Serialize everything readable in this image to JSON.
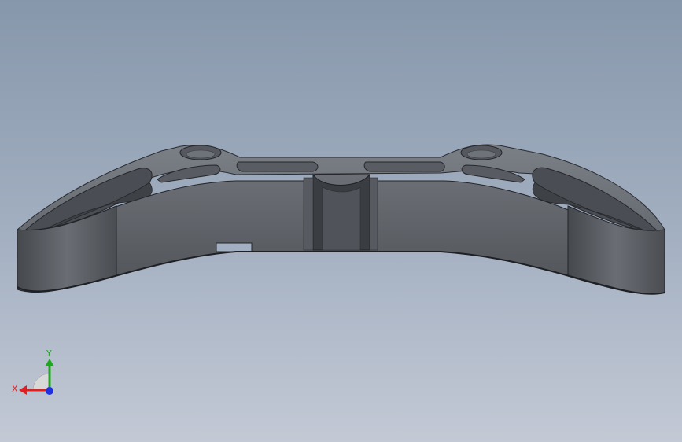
{
  "viewport": {
    "background_top": "#8797ab",
    "background_bottom": "#c3c9d5"
  },
  "model": {
    "name": "triple-clamp-part",
    "color": "#5f6267"
  },
  "triad": {
    "x_label": "X",
    "y_label": "Y",
    "x_color": "#e02020",
    "y_color": "#1fa81f",
    "z_color": "#2030e0"
  }
}
